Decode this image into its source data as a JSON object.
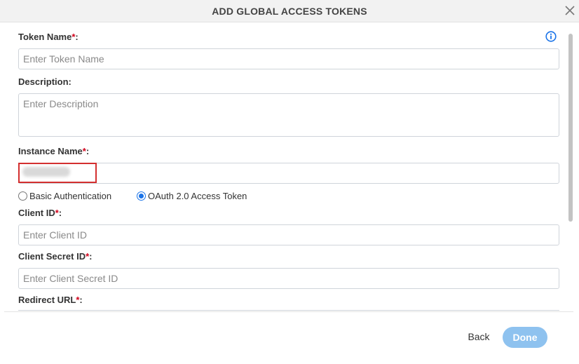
{
  "dialog": {
    "title": "ADD GLOBAL ACCESS TOKENS",
    "close_icon": "close-icon"
  },
  "form": {
    "token_name": {
      "label": "Token Name",
      "required_mark": "*",
      "suffix": ":",
      "placeholder": "Enter Token Name",
      "value": ""
    },
    "description": {
      "label": "Description:",
      "placeholder": "Enter Description",
      "value": ""
    },
    "instance_name": {
      "label": "Instance Name",
      "required_mark": "*",
      "suffix": ":",
      "value": ""
    },
    "auth_options": [
      {
        "label": "Basic Authentication",
        "selected": false
      },
      {
        "label": "OAuth 2.0 Access Token",
        "selected": true
      }
    ],
    "client_id": {
      "label": "Client ID",
      "required_mark": "*",
      "suffix": ":",
      "placeholder": "Enter Client ID",
      "value": ""
    },
    "client_secret_id": {
      "label": "Client Secret ID",
      "required_mark": "*",
      "suffix": ":",
      "placeholder": "Enter Client Secret ID",
      "value": ""
    },
    "redirect_url": {
      "label": "Redirect URL",
      "required_mark": "*",
      "suffix": ":"
    }
  },
  "footer": {
    "back_label": "Back",
    "done_label": "Done"
  },
  "colors": {
    "accent": "#1a73e8",
    "required": "#d0021b",
    "done_button": "#8ec2ef",
    "highlight_border": "#d32f2f"
  },
  "icons": {
    "info": "info-icon",
    "close": "close-icon"
  }
}
